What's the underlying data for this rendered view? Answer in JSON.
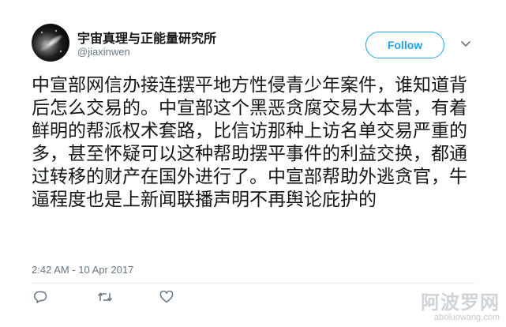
{
  "user": {
    "display_name": "宇宙真理与正能量研究所",
    "handle": "@jiaxinwen"
  },
  "header": {
    "follow_label": "Follow",
    "more_icon": "chevron-down-icon"
  },
  "tweet": {
    "text": "中宣部网信办接连摆平地方性侵青少年案件，谁知道背后怎么交易的。中宣部这个黑恶贪腐交易大本营，有着鲜明的帮派权术套路，比信访那种上访名单交易严重的多，甚至怀疑可以这种帮助摆平事件的利益交换，都通过转移的财产在国外进行了。中宣部帮助外逃贪官，牛逼程度也是上新闻联播声明不再舆论庇护的",
    "timestamp": "2:42 AM - 10 Apr 2017"
  },
  "actions": {
    "reply_icon": "reply-icon",
    "retweet_icon": "retweet-icon",
    "like_icon": "heart-icon"
  },
  "watermark": {
    "main": "阿波罗网",
    "sub": "aboluowang.com"
  },
  "colors": {
    "accent": "#1da1f2",
    "secondary_text": "#657786",
    "primary_text": "#14171a"
  }
}
